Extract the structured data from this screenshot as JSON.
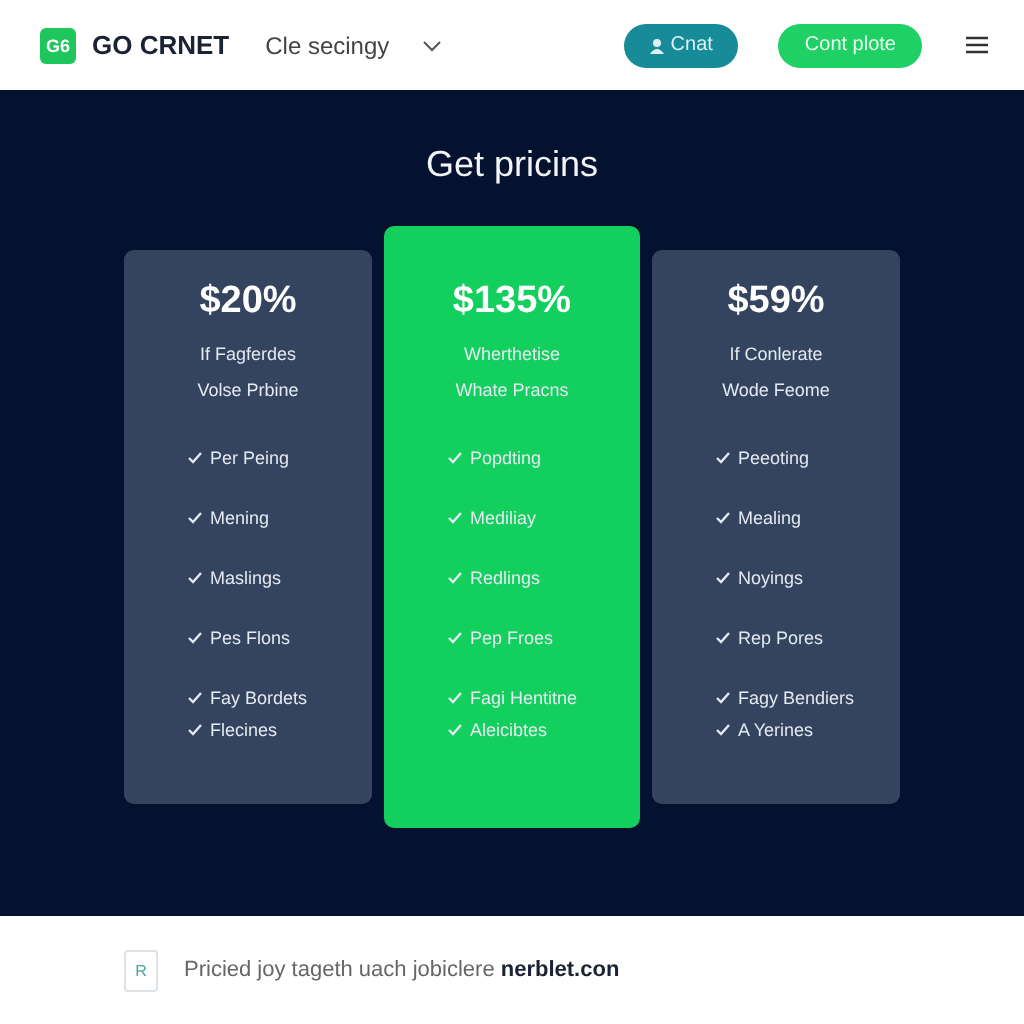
{
  "header": {
    "logo_mark": "G6",
    "brand": "GO CRNET",
    "menu": "Cle secingy",
    "buttons": [
      {
        "label": "Cnat",
        "kind": "outline"
      },
      {
        "label": "Cont plote",
        "kind": "primary"
      }
    ]
  },
  "title": "Get pricins",
  "plans": [
    {
      "price": "$20%",
      "subtitle": "If Fagferdes",
      "note": "Volse Prbine",
      "featured": false,
      "features": [
        "Per Peing",
        "Mening",
        "Maslings",
        "Pes Flons",
        "Fay Bordets",
        "Flecines"
      ]
    },
    {
      "price": "$135%",
      "subtitle": "Wherthetise",
      "note": "Whate Pracns",
      "featured": true,
      "features": [
        "Popdting",
        "Mediliay",
        "Redlings",
        "Pep Froes",
        "Fagi Hentitne",
        "Aleicibtes"
      ]
    },
    {
      "price": "$59%",
      "subtitle": "If Conlerate",
      "note": "Wode Feome",
      "featured": false,
      "features": [
        "Peeoting",
        "Mealing",
        "Noyings",
        "Rep Pores",
        "Fagy Bendiers",
        "A Yerines"
      ]
    }
  ],
  "footer": {
    "badge": "R",
    "text": "Pricied joy tageth uach jobiclere **nerblet.con**"
  }
}
